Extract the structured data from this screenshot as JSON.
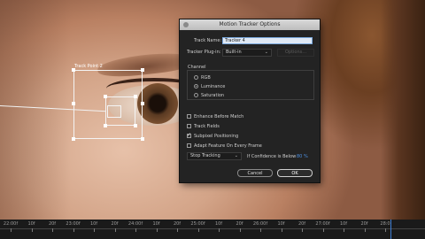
{
  "tracker_overlay": {
    "label": "Track Point 2"
  },
  "dialog": {
    "title": "Motion Tracker Options",
    "track_name_label": "Track Name:",
    "track_name_value": "Tracker 4",
    "plugin_label": "Tracker Plug-in:",
    "plugin_value": "Built-in",
    "options_button": "Options...",
    "channel_group": "Channel",
    "channels": [
      {
        "label": "RGB",
        "selected": false
      },
      {
        "label": "Luminance",
        "selected": true
      },
      {
        "label": "Saturation",
        "selected": false
      }
    ],
    "checkboxes": [
      {
        "label": "Enhance Before Match",
        "checked": false
      },
      {
        "label": "Track Fields",
        "checked": false
      },
      {
        "label": "Subpixel Positioning",
        "checked": true
      },
      {
        "label": "Adapt Feature On Every Frame",
        "checked": false
      }
    ],
    "confidence_action": "Stop Tracking",
    "confidence_label": "If Confidence is Below",
    "confidence_value": "80 %",
    "cancel_button": "Cancel",
    "ok_button": "OK"
  },
  "timeline": {
    "ticks": [
      "22:00f",
      "10f",
      "20f",
      "23:00f",
      "10f",
      "20f",
      "24:00f",
      "10f",
      "20f",
      "25:00f",
      "10f",
      "20f",
      "26:00f",
      "10f",
      "20f",
      "27:00f",
      "10f",
      "20f",
      "28:0"
    ]
  }
}
